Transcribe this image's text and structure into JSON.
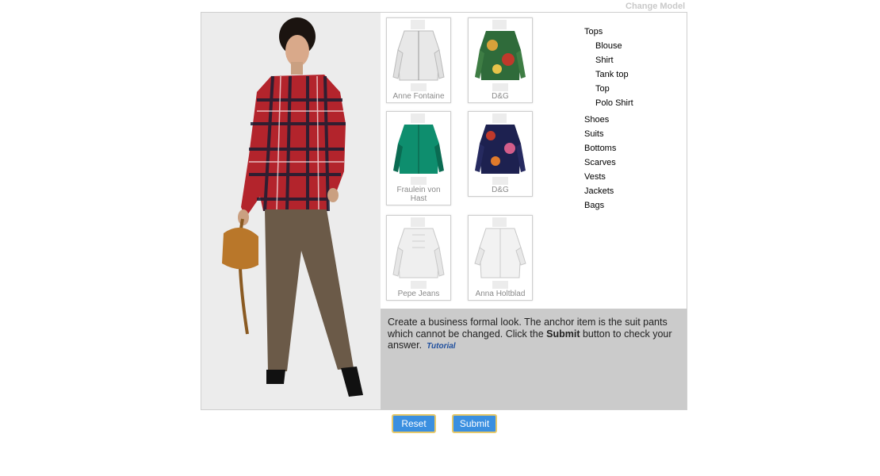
{
  "header": {
    "change_model_label": "Change Model"
  },
  "items": [
    {
      "label": "Anne Fontaine",
      "color": "#e8e8e8",
      "accent": "#cfcfcf"
    },
    {
      "label": "D&G",
      "color": "#2f6b3a",
      "accent": "#d9a23a"
    },
    {
      "label": "Fraulein von Hast",
      "color": "#0e8e6e",
      "accent": "#0a6b52"
    },
    {
      "label": "D&G",
      "color": "#1d2150",
      "accent": "#c0392b"
    },
    {
      "label": "Pepe Jeans",
      "color": "#efefef",
      "accent": "#d0d0d0"
    },
    {
      "label": "Anna Holtblad",
      "color": "#f2f2f2",
      "accent": "#d3d3d3"
    }
  ],
  "categories": {
    "tops": "Tops",
    "tops_sub": [
      "Blouse",
      "Shirt",
      "Tank top",
      "Top",
      "Polo Shirt"
    ],
    "others": [
      "Shoes",
      "Suits",
      "Bottoms",
      "Scarves",
      "Vests",
      "Jackets",
      "Bags"
    ]
  },
  "instructions": {
    "text_before": "Create a business formal look. The anchor item is the suit pants which cannot be changed. Click the ",
    "bold": "Submit",
    "text_after": " button to check your answer.",
    "tutorial_label": "Tutorial"
  },
  "buttons": {
    "reset_label": "Reset",
    "submit_label": "Submit"
  },
  "colors": {
    "button": "#3a8fe0",
    "button_border": "#e7c96a",
    "instruction_bg": "#cbcbcb"
  }
}
